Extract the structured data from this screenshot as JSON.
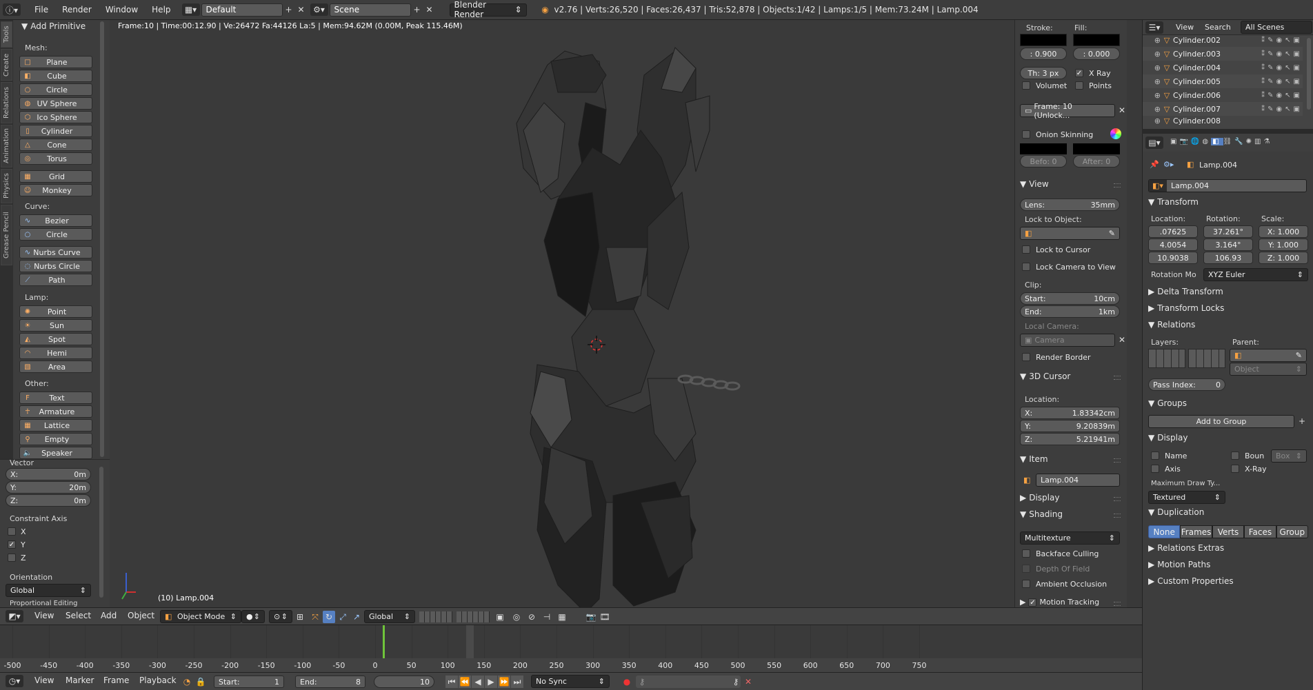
{
  "topbar": {
    "menus": [
      "File",
      "Render",
      "Window",
      "Help"
    ],
    "layout_value": "Default",
    "scene_value": "Scene",
    "engine_value": "Blender Render",
    "stats": "v2.76 | Verts:26,520 | Faces:26,437 | Tris:52,878 | Objects:1/42 | Lamps:1/5 | Mem:73.24M | Lamp.004"
  },
  "tabs": [
    "Tools",
    "Create",
    "Relations",
    "Animation",
    "Physics",
    "Grease Pencil"
  ],
  "shelf": {
    "title": "Add Primitive",
    "mesh_label": "Mesh:",
    "mesh": [
      "Plane",
      "Cube",
      "Circle",
      "UV Sphere",
      "Ico Sphere",
      "Cylinder",
      "Cone",
      "Torus",
      "Grid",
      "Monkey"
    ],
    "curve_label": "Curve:",
    "curve": [
      "Bezier",
      "Circle",
      "Nurbs Curve",
      "Nurbs Circle",
      "Path"
    ],
    "lamp_label": "Lamp:",
    "lamp": [
      "Point",
      "Sun",
      "Spot",
      "Hemi",
      "Area"
    ],
    "other_label": "Other:",
    "other": [
      "Text",
      "Armature",
      "Lattice",
      "Empty",
      "Speaker"
    ],
    "op": {
      "vector_label": "Vector",
      "x_label": "X:",
      "x_value": "0m",
      "y_label": "Y:",
      "y_value": "20m",
      "z_label": "Z:",
      "z_value": "0m",
      "constraint_label": "Constraint Axis",
      "axis_x": "X",
      "axis_y": "Y",
      "axis_z": "Z",
      "orientation_label": "Orientation",
      "orientation_value": "Global",
      "prop_edit_label": "Proportional Editing"
    }
  },
  "viewport": {
    "info": "Frame:10 | Time:00:12.90 | Ve:26472 Fa:44126 La:5 | Mem:94.62M (0.00M, Peak 115.46M)",
    "object_label": "(10) Lamp.004"
  },
  "npanel": {
    "stroke_label": "Stroke:",
    "fill_label": "Fill:",
    "stroke_value": ": 0.900",
    "fill_value": ": 0.000",
    "thickness": "Th: 3 px",
    "xray": "X Ray",
    "volumet": "Volumet",
    "points": "Points",
    "frame": "Frame: 10 (Unlock...",
    "onion": "Onion Skinning",
    "before": "Befo: 0",
    "after": "After: 0",
    "view": "View",
    "lens_label": "Lens:",
    "lens_value": "35mm",
    "lock_obj": "Lock to Object:",
    "lock_cursor": "Lock to Cursor",
    "lock_cam": "Lock Camera to View",
    "clip": "Clip:",
    "start_label": "Start:",
    "start_value": "10cm",
    "end_label": "End:",
    "end_value": "1km",
    "local_cam": "Local Camera:",
    "camera": "Camera",
    "render_border": "Render Border",
    "cursor": "3D Cursor",
    "location": "Location:",
    "cx_label": "X:",
    "cx": "1.83342cm",
    "cy_label": "Y:",
    "cy": "9.20839m",
    "cz_label": "Z:",
    "cz": "5.21941m",
    "item": "Item",
    "item_name": "Lamp.004",
    "display": "Display",
    "shading": "Shading",
    "shading_mode": "Multitexture",
    "backface": "Backface Culling",
    "dof": "Depth Of Field",
    "ao": "Ambient Occlusion",
    "motion": "Motion Tracking"
  },
  "outliner": {
    "view": "View",
    "search": "Search",
    "scenes": "All Scenes",
    "items": [
      "Cylinder.002",
      "Cylinder.003",
      "Cylinder.004",
      "Cylinder.005",
      "Cylinder.006",
      "Cylinder.007",
      "Cylinder.008"
    ]
  },
  "props": {
    "breadcrumb": "Lamp.004",
    "name": "Lamp.004",
    "transform": "Transform",
    "location_label": "Location:",
    "rotation_label": "Rotation:",
    "scale_label": "Scale:",
    "loc": [
      ".07625",
      "4.0054",
      "10.9038"
    ],
    "rot": [
      "37.261°",
      "3.164°",
      "106.93"
    ],
    "scale": [
      "X: 1.000",
      "Y: 1.000",
      "Z: 1.000"
    ],
    "rotmode_label": "Rotation Mo",
    "rotmode_value": "XYZ Euler",
    "delta": "Delta Transform",
    "locks": "Transform Locks",
    "relations": "Relations",
    "layers": "Layers:",
    "parent": "Parent:",
    "object_ph": "Object",
    "pass_label": "Pass Index:",
    "pass_value": "0",
    "groups": "Groups",
    "add_group": "Add to Group",
    "display": "Display",
    "name_chk": "Name",
    "bounds_chk": "Boun",
    "box": "Box",
    "axis_chk": "Axis",
    "xray_chk": "X-Ray",
    "maxdraw_label": "Maximum Draw Ty...",
    "maxdraw_value": "Textured",
    "duplication": "Duplication",
    "dup": [
      "None",
      "Frames",
      "Verts",
      "Faces",
      "Group"
    ],
    "rel_extras": "Relations Extras",
    "motion_paths": "Motion Paths",
    "custom": "Custom Properties"
  },
  "v3hdr": {
    "view": "View",
    "select": "Select",
    "add": "Add",
    "object": "Object",
    "mode": "Object Mode",
    "orient": "Global"
  },
  "timeline": {
    "ticks": [
      "-500",
      "-450",
      "-400",
      "-350",
      "-300",
      "-250",
      "-200",
      "-150",
      "-100",
      "-50",
      "0",
      "50",
      "100",
      "150",
      "200",
      "250",
      "300",
      "350",
      "400",
      "450",
      "500",
      "550",
      "600",
      "650",
      "700",
      "750"
    ],
    "current_frame": 10
  },
  "tlhdr": {
    "view": "View",
    "marker": "Marker",
    "frame": "Frame",
    "playback": "Playback",
    "start_label": "Start:",
    "start_value": "1",
    "end_label": "End:",
    "end_value": "8",
    "current": "10",
    "sync": "No Sync"
  },
  "colors": {
    "accent_blue": "#5680c2",
    "lamp_icon": "#f5a142",
    "playhead": "#6fc43a"
  }
}
